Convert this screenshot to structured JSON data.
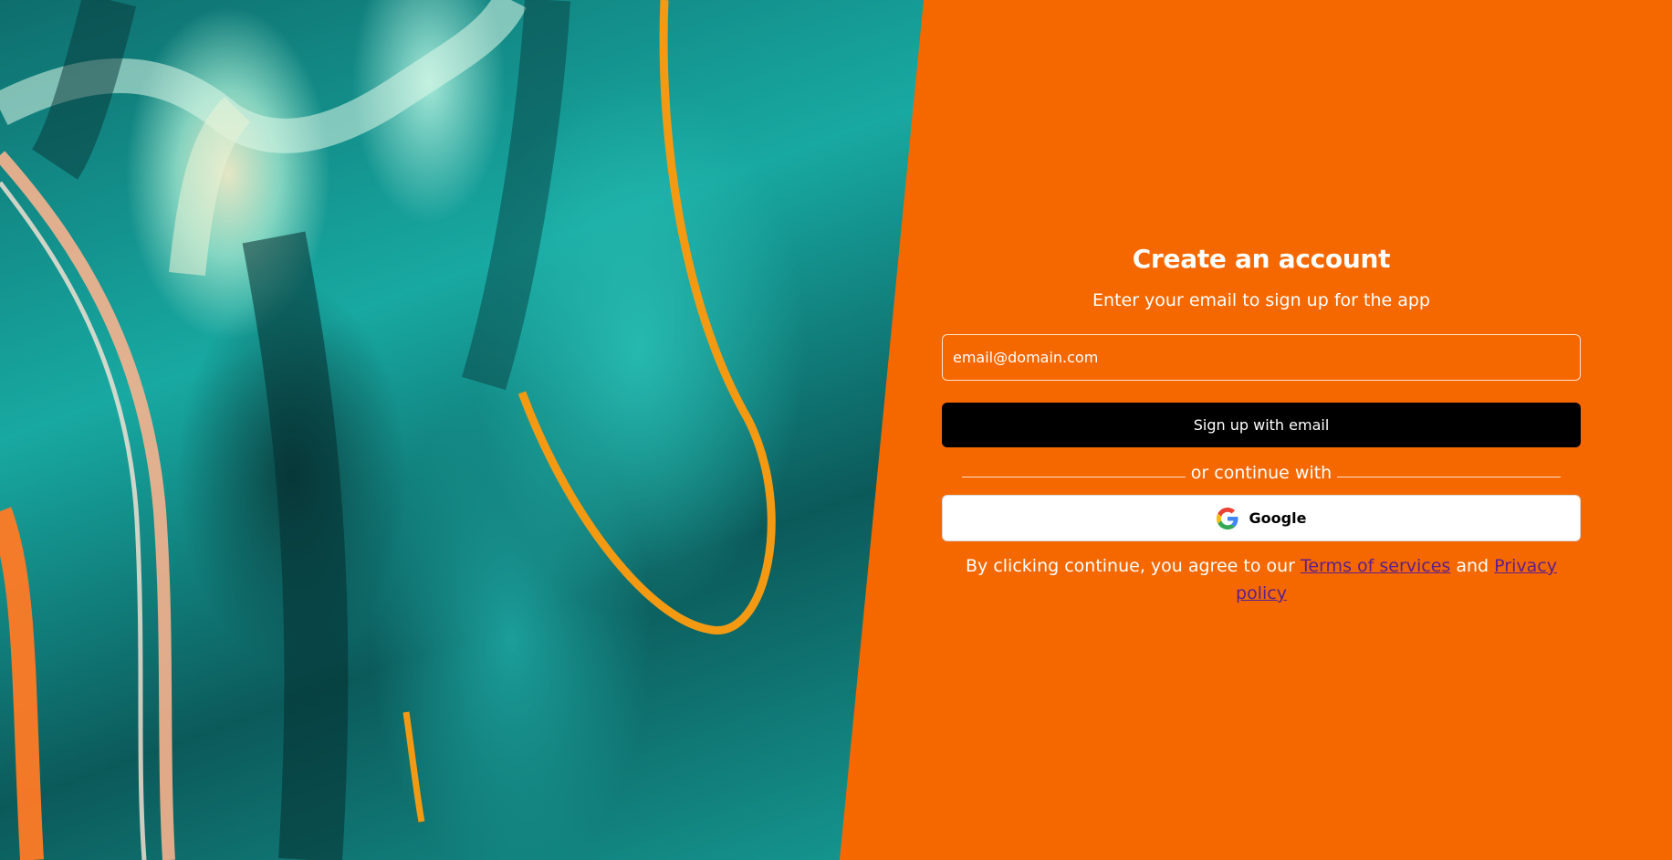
{
  "theme": {
    "background": "#f56800",
    "button_primary": "#000000",
    "link": "#5b1f8f"
  },
  "form": {
    "title": "Create an account",
    "subtitle": "Enter your email to sign up for the app",
    "email_placeholder": "email@domain.com",
    "email_value": "",
    "signup_label": "Sign up with email",
    "divider_text": "or continue with",
    "google_label": "Google",
    "google_icon": "google-icon"
  },
  "legal": {
    "prefix": "By clicking continue, you agree to our",
    "terms_link": "Terms of services",
    "conjunction": "and",
    "privacy_link": "Privacy policy"
  }
}
